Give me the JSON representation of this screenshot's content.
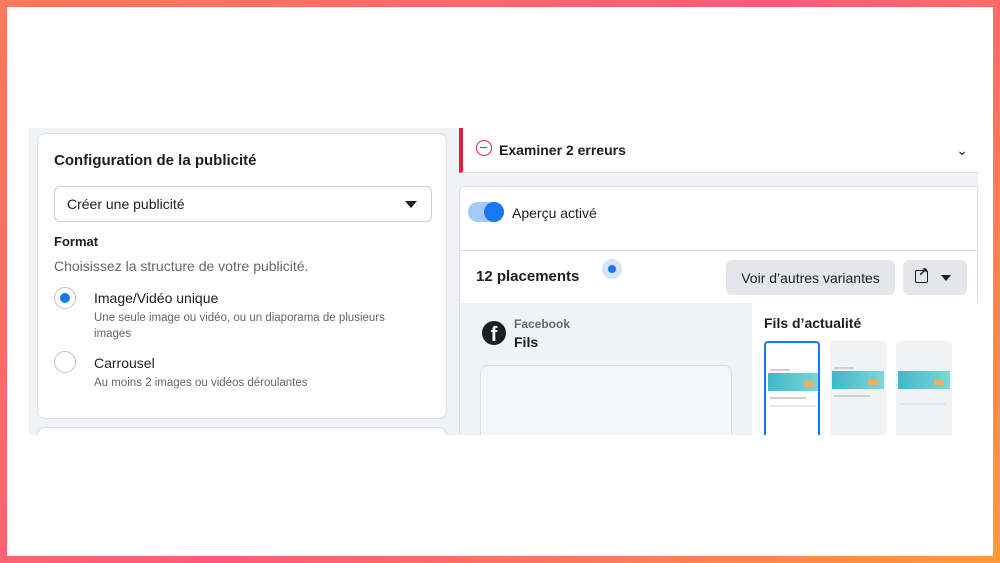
{
  "config": {
    "title": "Configuration de la publicité",
    "select_value": "Créer une publicité",
    "format_label": "Format",
    "format_desc": "Choisissez la structure de votre publicité.",
    "options": [
      {
        "title": "Image/Vidéo unique",
        "subtitle": "Une seule image ou vidéo, ou un diaporama de plusieurs images",
        "selected": true
      },
      {
        "title": "Carrousel",
        "subtitle": "Au moins 2 images ou vidéos déroulantes",
        "selected": false
      }
    ]
  },
  "errors": {
    "label": "Examiner 2 erreurs",
    "color": "#e41e3f"
  },
  "preview": {
    "toggle_label": "Aperçu activé",
    "toggle_on": true,
    "placements_label": "12 placements",
    "variants_button": "Voir d’autres variantes",
    "platform": "Facebook",
    "placement": "Fils",
    "feed_title": "Fils d’actualité"
  },
  "colors": {
    "accent": "#1877f2"
  }
}
